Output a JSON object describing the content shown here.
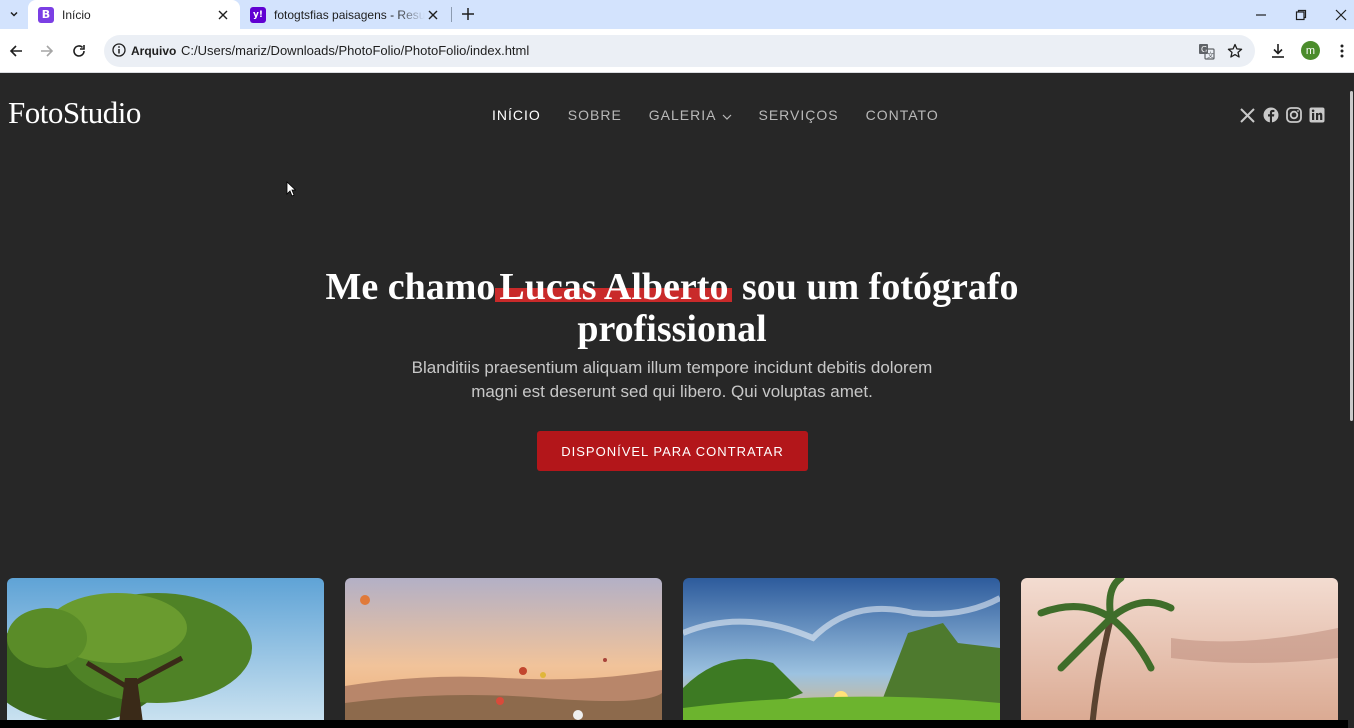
{
  "browser": {
    "tabs": [
      {
        "title": "Início",
        "favicon": "B",
        "favicon_color": "#7b3fe4",
        "active": true
      },
      {
        "title": "fotogtsfias paisagens - Resultad",
        "favicon": "y!",
        "favicon_color": "#6001d2",
        "active": false
      }
    ],
    "site_chip": "Arquivo",
    "url": "C:/Users/mariz/Downloads/PhotoFolio/PhotoFolio/index.html",
    "profile_initial": "m",
    "icons": [
      "tab-search-icon",
      "close-icon",
      "new-tab-icon",
      "minimize-icon",
      "restore-icon",
      "close-window-icon",
      "back-icon",
      "forward-icon",
      "reload-icon",
      "info-icon",
      "translate-icon",
      "star-icon",
      "download-icon",
      "more-icon"
    ]
  },
  "site": {
    "logo": "FotoStudio",
    "nav": [
      {
        "label": "INÍCIO",
        "active": true
      },
      {
        "label": "SOBRE",
        "active": false
      },
      {
        "label": "GALERIA",
        "active": false,
        "dropdown": true
      },
      {
        "label": "SERVIÇOS",
        "active": false
      },
      {
        "label": "CONTATO",
        "active": false
      }
    ],
    "socials": [
      "x-icon",
      "facebook-icon",
      "instagram-icon",
      "linkedin-icon"
    ],
    "hero": {
      "title_before": "Me chamo",
      "title_highlight": "Lucas Alberto",
      "title_after": "sou um fotógrafo profissional",
      "subtitle": "Blanditiis praesentium aliquam illum tempore incidunt debitis dolorem magni est deserunt sed qui libero. Qui voluptas amet.",
      "cta": "DISPONÍVEL PARA CONTRATAR"
    },
    "gallery": [
      "tree-landscape-image",
      "hot-air-balloons-image",
      "green-valley-sunset-image",
      "palm-tree-beach-image"
    ],
    "colors": {
      "background": "#272727",
      "accent": "#b3161a",
      "highlight": "#c92a2a"
    }
  }
}
